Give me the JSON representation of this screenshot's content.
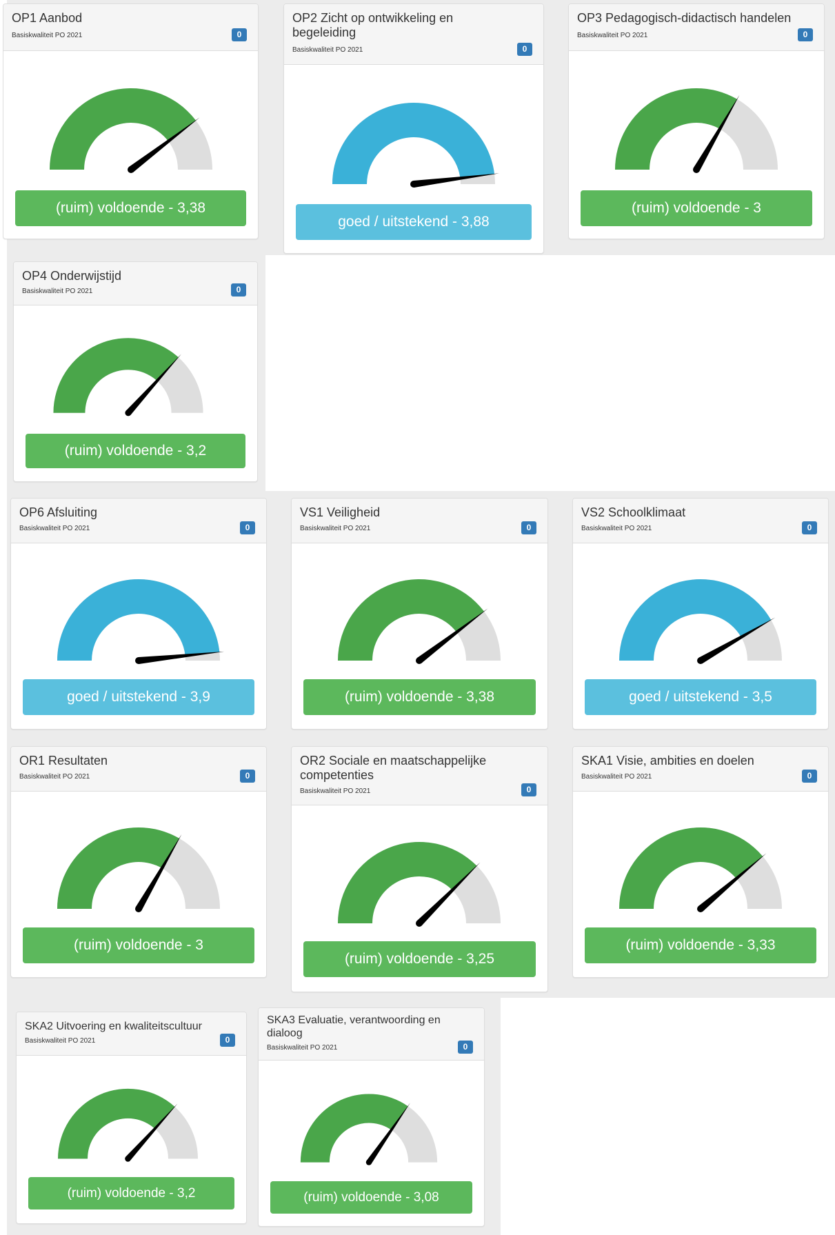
{
  "colors": {
    "good": "#5cb85c",
    "excellent": "#5bc0de",
    "arc_good": "#4aa64a",
    "arc_excellent": "#3ab1d8",
    "arc_track": "#dedede",
    "badge": "#337ab7",
    "needle": "#000000"
  },
  "cards": [
    {
      "title": "OP1 Aanbod",
      "subtitle": "Basiskwaliteit PO 2021",
      "badge": "0",
      "status": "(ruim) voldoende - 3,38",
      "score": 3.38,
      "level": "good"
    },
    {
      "title": "OP2 Zicht op ontwikkeling en begeleiding",
      "subtitle": "Basiskwaliteit PO 2021",
      "badge": "0",
      "status": "goed / uitstekend - 3,88",
      "score": 3.88,
      "level": "excellent"
    },
    {
      "title": "OP3 Pedagogisch-didactisch handelen",
      "subtitle": "Basiskwaliteit PO 2021",
      "badge": "0",
      "status": "(ruim) voldoende - 3",
      "score": 3.0,
      "level": "good"
    },
    {
      "title": "OP4 Onderwijstijd",
      "subtitle": "Basiskwaliteit PO 2021",
      "badge": "0",
      "status": "(ruim) voldoende - 3,2",
      "score": 3.2,
      "level": "good"
    },
    {
      "title": "OP6 Afsluiting",
      "subtitle": "Basiskwaliteit PO 2021",
      "badge": "0",
      "status": "goed / uitstekend - 3,9",
      "score": 3.9,
      "level": "excellent"
    },
    {
      "title": "VS1 Veiligheid",
      "subtitle": "Basiskwaliteit PO 2021",
      "badge": "0",
      "status": "(ruim) voldoende - 3,38",
      "score": 3.38,
      "level": "good"
    },
    {
      "title": "VS2 Schoolklimaat",
      "subtitle": "Basiskwaliteit PO 2021",
      "badge": "0",
      "status": "goed / uitstekend - 3,5",
      "score": 3.5,
      "level": "excellent"
    },
    {
      "title": "OR1 Resultaten",
      "subtitle": "Basiskwaliteit PO 2021",
      "badge": "0",
      "status": "(ruim) voldoende - 3",
      "score": 3.0,
      "level": "good"
    },
    {
      "title": "OR2 Sociale en maatschappelijke competenties",
      "subtitle": "Basiskwaliteit PO 2021",
      "badge": "0",
      "status": "(ruim) voldoende - 3,25",
      "score": 3.25,
      "level": "good"
    },
    {
      "title": "SKA1 Visie, ambities en doelen",
      "subtitle": "Basiskwaliteit PO 2021",
      "badge": "0",
      "status": "(ruim) voldoende - 3,33",
      "score": 3.33,
      "level": "good"
    },
    {
      "title": "SKA2 Uitvoering en kwaliteitscultuur",
      "subtitle": "Basiskwaliteit PO 2021",
      "badge": "0",
      "status": "(ruim) voldoende - 3,2",
      "score": 3.2,
      "level": "good"
    },
    {
      "title": "SKA3 Evaluatie, verantwoording en dialoog",
      "subtitle": "Basiskwaliteit PO 2021",
      "badge": "0",
      "status": "(ruim) voldoende - 3,08",
      "score": 3.08,
      "level": "good"
    }
  ]
}
